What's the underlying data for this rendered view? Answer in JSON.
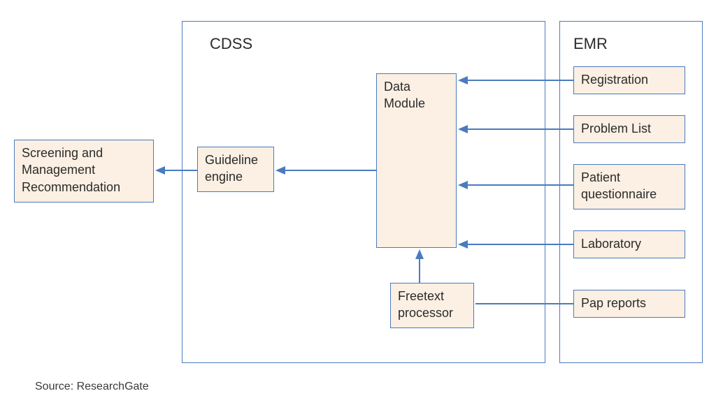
{
  "containers": {
    "cdss": {
      "title": "CDSS"
    },
    "emr": {
      "title": "EMR"
    }
  },
  "nodes": {
    "output": {
      "label": "Screening and\nManagement\nRecommendation"
    },
    "guideline": {
      "label": "Guideline\nengine"
    },
    "datamodule": {
      "label": "Data\nModule"
    },
    "freetext": {
      "label": "Freetext\nprocessor"
    },
    "registration": {
      "label": "Registration"
    },
    "problemlist": {
      "label": "Problem List"
    },
    "questionnaire": {
      "label": "Patient\nquestionnaire"
    },
    "laboratory": {
      "label": "Laboratory"
    },
    "papreports": {
      "label": "Pap reports"
    }
  },
  "source_text": "Source: ResearchGate",
  "colors": {
    "border": "#4a7bbf",
    "fill": "#fbf0e3",
    "arrow": "#4a7bbf"
  }
}
